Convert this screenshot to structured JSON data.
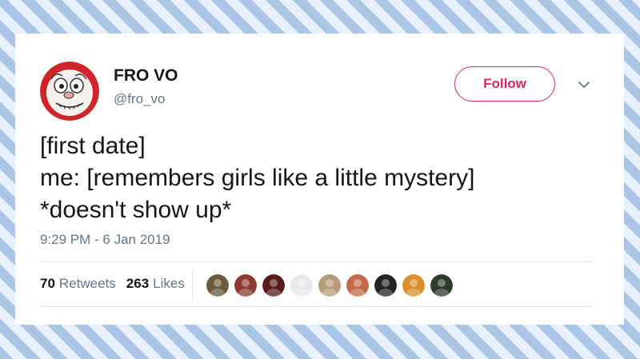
{
  "tweet": {
    "display_name": "FRO VO",
    "handle": "@fro_vo",
    "follow_label": "Follow",
    "text_lines": [
      "[first date]",
      "me: [remembers girls like a little mystery]",
      "*doesn't show up*"
    ],
    "timestamp": "9:29 PM - 6 Jan 2019",
    "retweets": {
      "count": "70",
      "label": "Retweets"
    },
    "likes": {
      "count": "263",
      "label": "Likes"
    }
  },
  "colors": {
    "follow_accent": "#e0245e",
    "secondary_text": "#657786",
    "primary_text": "#14171a",
    "avatar_ring": "#d0242b"
  },
  "liker_avatars": [
    {
      "icon": "liker-avatar-icon",
      "color": "#6b5a3a"
    },
    {
      "icon": "liker-avatar-icon",
      "color": "#8a3b2e"
    },
    {
      "icon": "liker-avatar-icon",
      "color": "#5a1a1a"
    },
    {
      "icon": "liker-avatar-icon",
      "color": "#e8e8e8"
    },
    {
      "icon": "liker-avatar-icon",
      "color": "#b79a7a"
    },
    {
      "icon": "liker-avatar-icon",
      "color": "#c46a4a"
    },
    {
      "icon": "liker-avatar-icon",
      "color": "#222222"
    },
    {
      "icon": "liker-avatar-icon",
      "color": "#d9902a"
    },
    {
      "icon": "liker-avatar-icon",
      "color": "#2d3b2a"
    }
  ]
}
